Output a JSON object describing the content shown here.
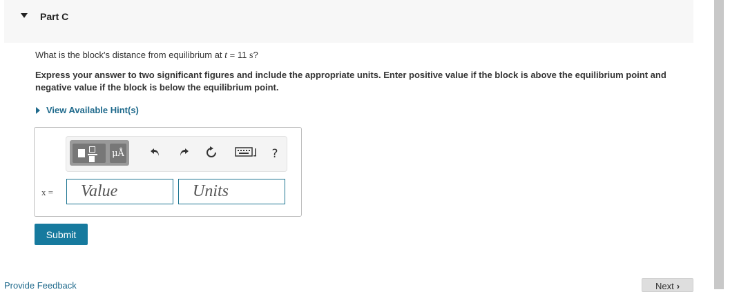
{
  "part": {
    "title": "Part C"
  },
  "question": {
    "prefix": "What is the block's distance from equilibrium at ",
    "variable": "t",
    "equals": " = 11 ",
    "unit": "s",
    "suffix": "?"
  },
  "instructions": "Express your answer to two significant figures and include the appropriate units. Enter positive value if the block is above the equilibrium point and negative value if the block is below the equilibrium point.",
  "hint": {
    "label": "View Available Hint(s)"
  },
  "toolbar": {
    "units_button": "μÅ",
    "undo_icon": "undo-icon",
    "redo_icon": "redo-icon",
    "reset_icon": "reset-icon",
    "keyboard_icon": "keyboard-icon",
    "help_label": "?"
  },
  "answer": {
    "variable_label": "x =",
    "value_placeholder": "Value",
    "units_placeholder": "Units"
  },
  "submit_label": "Submit",
  "feedback_label": "Provide Feedback",
  "next_label": "Next",
  "colors": {
    "accent": "#167a9e",
    "link": "#1f6a8c"
  }
}
